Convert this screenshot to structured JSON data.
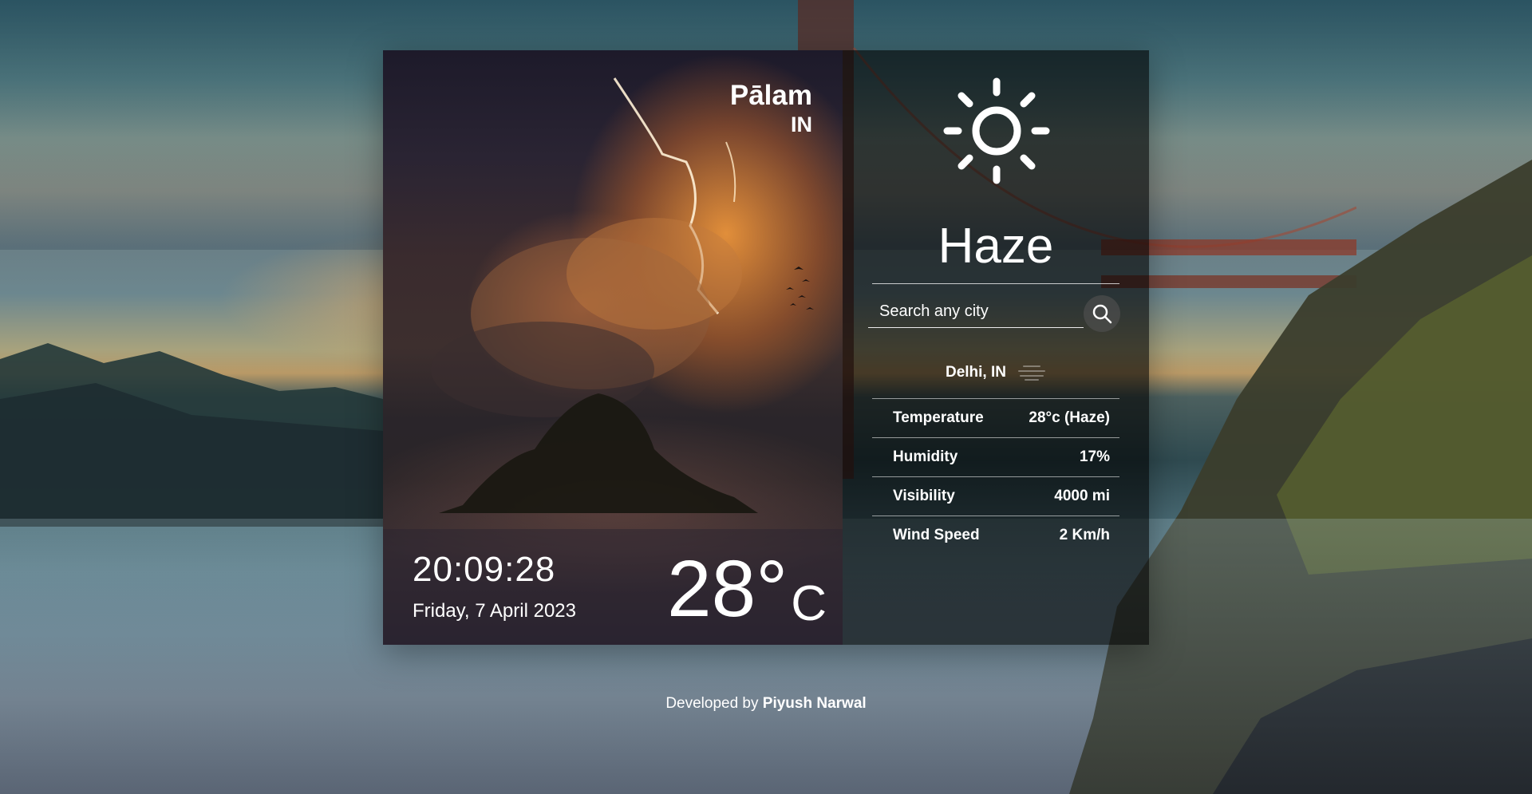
{
  "location": {
    "city": "Pālam",
    "country": "IN"
  },
  "clock": {
    "time": "20:09:28",
    "date": "Friday, 7 April 2023"
  },
  "current": {
    "temperature": "28°",
    "unit": "C",
    "condition": "Haze",
    "condition_icon": "sun-icon"
  },
  "search": {
    "placeholder": "Search any city",
    "button_icon": "search-icon"
  },
  "result": {
    "city": "Delhi, IN",
    "icon": "haze-icon"
  },
  "stats": [
    {
      "label": "Temperature",
      "value": "28°c (Haze)"
    },
    {
      "label": "Humidity",
      "value": "17%"
    },
    {
      "label": "Visibility",
      "value": "4000 mi"
    },
    {
      "label": "Wind Speed",
      "value": "2 Km/h"
    }
  ],
  "footer": {
    "prefix": "Developed by ",
    "author": "Piyush Narwal"
  },
  "colors": {
    "panel_overlay": "#000000",
    "text": "#ffffff",
    "storm_accent": "#f0913a"
  }
}
